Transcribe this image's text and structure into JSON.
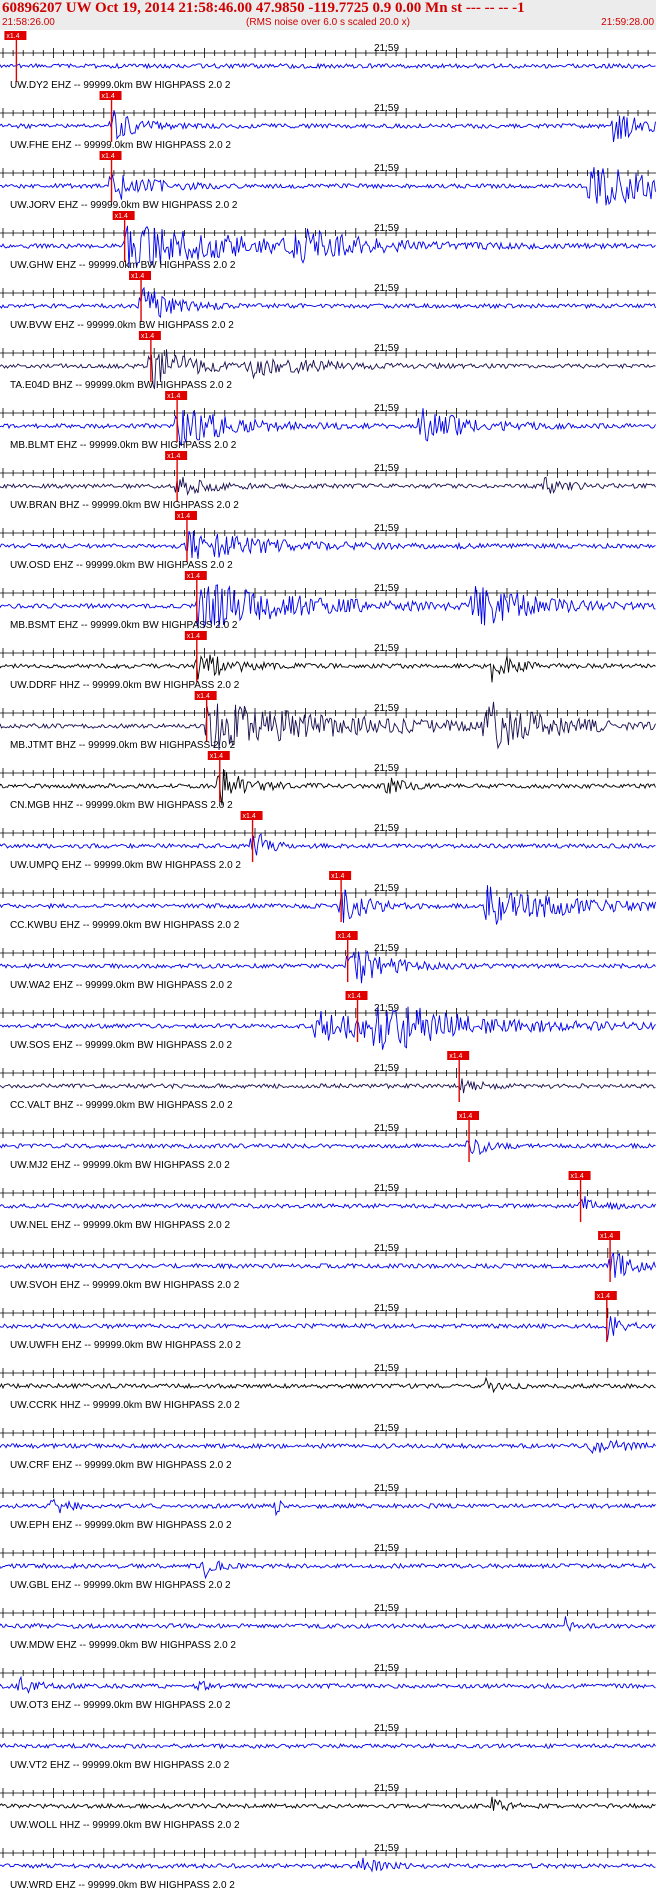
{
  "header": {
    "title": "60896207 UW Oct 19, 2014 21:58:46.00   47.9850 -119.7725  0.9 0.00 Mn st --- -- --   -1",
    "start_time": "21:58:26.00",
    "note": "(RMS noise over 6.0 s scaled 20.0 x)",
    "end_time": "21:59:28.00"
  },
  "chart_data": {
    "type": "line",
    "time_range": [
      "21:58:26.00",
      "21:59:28.00"
    ],
    "minute_tick_label": "21:59",
    "pick_label": "x1.4",
    "colors": {
      "pick": "#e00000",
      "blue": "#0000ee",
      "navy": "#1a1050",
      "black": "#000000",
      "header_text": "#d00000"
    },
    "traces": [
      {
        "label": "UW.DY2 EHZ -- 99999.0km BW  HIGHPASS  2.0  2",
        "color": "blue",
        "pick": 0.025,
        "events": []
      },
      {
        "label": "UW.FHE EHZ -- 99999.0km BW  HIGHPASS  2.0  2",
        "color": "blue",
        "pick": 0.17,
        "events": [
          [
            0.17,
            0.9,
            0.03
          ],
          [
            0.935,
            0.7,
            0.04
          ]
        ]
      },
      {
        "label": "UW.JORV EHZ -- 99999.0km BW  HIGHPASS  2.0  2",
        "color": "blue",
        "pick": 0.17,
        "events": [
          [
            0.17,
            0.7,
            0.05
          ],
          [
            0.9,
            1.0,
            0.12
          ]
        ]
      },
      {
        "label": "UW.GHW EHZ -- 99999.0km BW  HIGHPASS  2.0  2",
        "color": "blue",
        "pick": 0.19,
        "events": [
          [
            0.19,
            0.9,
            0.18
          ],
          [
            0.45,
            0.6,
            0.08
          ]
        ]
      },
      {
        "label": "UW.BVW EHZ -- 99999.0km BW  HIGHPASS  2.0  2",
        "color": "blue",
        "pick": 0.215,
        "events": [
          [
            0.215,
            0.9,
            0.04
          ]
        ]
      },
      {
        "label": "TA.E04D BHZ -- 99999.0km BW  HIGHPASS  2.0  2",
        "color": "navy",
        "pick": 0.23,
        "events": [
          [
            0.23,
            1.0,
            0.05
          ],
          [
            0.38,
            0.4,
            0.1
          ]
        ]
      },
      {
        "label": "MB.BLMT EHZ -- 99999.0km BW  HIGHPASS  2.0  2",
        "color": "blue",
        "pick": 0.27,
        "events": [
          [
            0.27,
            0.8,
            0.08
          ],
          [
            0.64,
            0.7,
            0.07
          ]
        ]
      },
      {
        "label": "UW.BRAN BHZ -- 99999.0km BW  HIGHPASS  2.0  2",
        "color": "navy",
        "pick": 0.27,
        "events": [
          [
            0.27,
            0.5,
            0.04
          ],
          [
            0.83,
            0.3,
            0.03
          ]
        ]
      },
      {
        "label": "UW.OSD EHZ -- 99999.0km BW  HIGHPASS  2.0  2",
        "color": "blue",
        "pick": 0.285,
        "events": [
          [
            0.285,
            0.6,
            0.12
          ]
        ]
      },
      {
        "label": "MB.BSMT EHZ -- 99999.0km BW  HIGHPASS  2.0  2",
        "color": "blue",
        "pick": 0.3,
        "events": [
          [
            0.3,
            1.0,
            0.15
          ],
          [
            0.72,
            1.0,
            0.08
          ]
        ]
      },
      {
        "label": "UW.DDRF HHZ -- 99999.0km BW  HIGHPASS  2.0  2",
        "color": "black",
        "pick": 0.3,
        "events": [
          [
            0.3,
            0.6,
            0.05
          ],
          [
            0.75,
            0.7,
            0.03
          ]
        ]
      },
      {
        "label": "MB.JTMT BHZ -- 99999.0km BW  HIGHPASS  2.0  2",
        "color": "navy",
        "pick": 0.315,
        "events": [
          [
            0.315,
            1.0,
            0.2
          ],
          [
            0.74,
            1.0,
            0.08
          ]
        ]
      },
      {
        "label": "CN.MGB HHZ -- 99999.0km BW  HIGHPASS  2.0  2",
        "color": "black",
        "pick": 0.335,
        "events": [
          [
            0.335,
            0.8,
            0.04
          ],
          [
            0.59,
            0.6,
            0.02
          ]
        ]
      },
      {
        "label": "UW.UMPQ EHZ -- 99999.0km BW  HIGHPASS  2.0  2",
        "color": "blue",
        "pick": 0.385,
        "events": [
          [
            0.385,
            0.8,
            0.02
          ]
        ]
      },
      {
        "label": "CC.KWBU EHZ -- 99999.0km BW  HIGHPASS  2.0  2",
        "color": "blue",
        "pick": 0.52,
        "events": [
          [
            0.52,
            0.7,
            0.04
          ],
          [
            0.74,
            0.8,
            0.12
          ]
        ]
      },
      {
        "label": "UW.WA2 EHZ -- 99999.0km BW  HIGHPASS  2.0  2",
        "color": "blue",
        "pick": 0.53,
        "events": [
          [
            0.53,
            1.0,
            0.05
          ]
        ]
      },
      {
        "label": "UW.SOS EHZ -- 99999.0km BW  HIGHPASS  2.0  2",
        "color": "blue",
        "pick": 0.545,
        "events": [
          [
            0.48,
            0.6,
            0.2
          ],
          [
            0.57,
            0.9,
            0.1
          ]
        ]
      },
      {
        "label": "CC.VALT BHZ -- 99999.0km BW  HIGHPASS  2.0  2",
        "color": "navy",
        "pick": 0.7,
        "events": [
          [
            0.7,
            0.3,
            0.03
          ]
        ]
      },
      {
        "label": "UW.MJ2 EHZ -- 99999.0km BW  HIGHPASS  2.0  2",
        "color": "blue",
        "pick": 0.715,
        "events": [
          [
            0.715,
            0.6,
            0.02
          ]
        ]
      },
      {
        "label": "UW.NEL EHZ -- 99999.0km BW  HIGHPASS  2.0  2",
        "color": "blue",
        "pick": 0.885,
        "events": [
          [
            0.885,
            0.4,
            0.03
          ]
        ]
      },
      {
        "label": "UW.SVOH EHZ -- 99999.0km BW  HIGHPASS  2.0  2",
        "color": "blue",
        "pick": 0.93,
        "events": [
          [
            0.93,
            0.7,
            0.03
          ]
        ]
      },
      {
        "label": "UW.UWFH EHZ -- 99999.0km BW  HIGHPASS  2.0  2",
        "color": "blue",
        "pick": 0.925,
        "events": [
          [
            0.925,
            0.6,
            0.02
          ]
        ]
      },
      {
        "label": "UW.CCRK HHZ -- 99999.0km BW  HIGHPASS  2.0  2",
        "color": "black",
        "pick": null,
        "events": [
          [
            0.74,
            0.3,
            0.02
          ]
        ]
      },
      {
        "label": "UW.CRF EHZ -- 99999.0km BW  HIGHPASS  2.0  2",
        "color": "blue",
        "pick": null,
        "events": [
          [
            0.9,
            0.3,
            0.05
          ]
        ]
      },
      {
        "label": "UW.EPH EHZ -- 99999.0km BW  HIGHPASS  2.0  2",
        "color": "blue",
        "pick": null,
        "events": [
          [
            0.08,
            0.4,
            0.02
          ],
          [
            0.42,
            0.6,
            0.005
          ]
        ]
      },
      {
        "label": "UW.GBL EHZ -- 99999.0km BW  HIGHPASS  2.0  2",
        "color": "blue",
        "pick": null,
        "events": [
          [
            0.31,
            0.6,
            0.015
          ]
        ]
      },
      {
        "label": "UW.MDW EHZ -- 99999.0km BW  HIGHPASS  2.0  2",
        "color": "blue",
        "pick": null,
        "events": [
          [
            0.86,
            0.4,
            0.01
          ]
        ]
      },
      {
        "label": "UW.OT3 EHZ -- 99999.0km BW  HIGHPASS  2.0  2",
        "color": "blue",
        "pick": null,
        "events": [
          [
            0.03,
            0.4,
            0.02
          ],
          [
            0.3,
            0.3,
            0.01
          ]
        ]
      },
      {
        "label": "UW.VT2 EHZ -- 99999.0km BW  HIGHPASS  2.0  2",
        "color": "blue",
        "pick": null,
        "events": []
      },
      {
        "label": "UW.WOLL HHZ -- 99999.0km BW  HIGHPASS  2.0  2",
        "color": "black",
        "pick": null,
        "events": [
          [
            0.75,
            0.3,
            0.02
          ]
        ]
      },
      {
        "label": "UW.WRD EHZ -- 99999.0km BW  HIGHPASS  2.0  2",
        "color": "blue",
        "pick": null,
        "events": [
          [
            0.55,
            0.3,
            0.03
          ]
        ]
      }
    ]
  }
}
